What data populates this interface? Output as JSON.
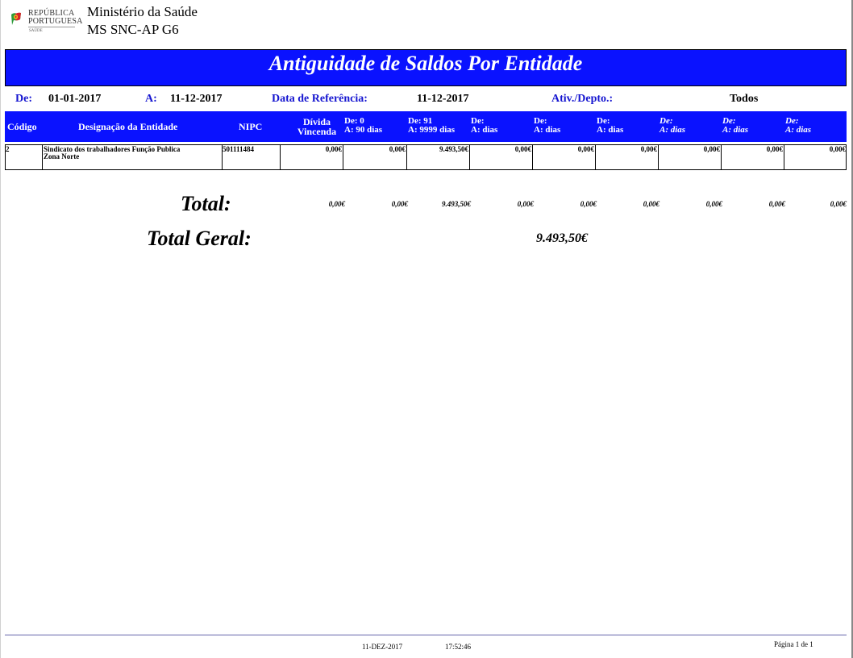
{
  "header": {
    "logo": {
      "line1": "REPÚBLICA",
      "line2": "PORTUGUESA",
      "sub": "SAÚDE"
    },
    "org_line1": "Ministério da Saúde",
    "org_line2": "MS SNC-AP G6"
  },
  "title": "Antiguidade de Saldos Por Entidade",
  "params": {
    "de_label": "De:",
    "de_value": "01-01-2017",
    "a_label": "A:",
    "a_value": "11-12-2017",
    "ref_label": "Data de Referência:",
    "ref_value": "11-12-2017",
    "ativ_label": "Ativ./Depto.:",
    "ativ_value": "Todos"
  },
  "columns": {
    "codigo": "Código",
    "designacao": "Designação da Entidade",
    "nipc": "NIPC",
    "divida1": "Dívida",
    "divida2": "Vincenda",
    "b1": [
      "De: 0",
      "A: 90 dias"
    ],
    "b2": [
      "De: 91",
      "A: 9999 dias"
    ],
    "b3": [
      "De:",
      "A:  dias"
    ],
    "b4": [
      "De:",
      "A:  dias"
    ],
    "b5": [
      "De:",
      "A:  dias"
    ],
    "b6": [
      "De:",
      "A:  dias"
    ],
    "b7": [
      "De:",
      "A:  dias"
    ],
    "b8": [
      "De:",
      "A:  dias"
    ]
  },
  "rows": [
    {
      "codigo": "2",
      "designacao1": "Sindicato dos trabalhadores Função Publica",
      "designacao2": "Zona Norte",
      "nipc": "501111484",
      "values": [
        "0,00€",
        "0,00€",
        "9.493,50€",
        "0,00€",
        "0,00€",
        "0,00€",
        "0,00€",
        "0,00€",
        "0,00€"
      ]
    }
  ],
  "totals": {
    "label": "Total:",
    "values": [
      "0,00€",
      "0,00€",
      "9.493,50€",
      "0,00€",
      "0,00€",
      "0,00€",
      "0,00€",
      "0,00€",
      "0,00€"
    ],
    "geral_label": "Total Geral:",
    "geral_value": "9.493,50€"
  },
  "footer": {
    "date": "11-DEZ-2017",
    "time": "17:52:46",
    "page": "Página 1 de 1"
  }
}
